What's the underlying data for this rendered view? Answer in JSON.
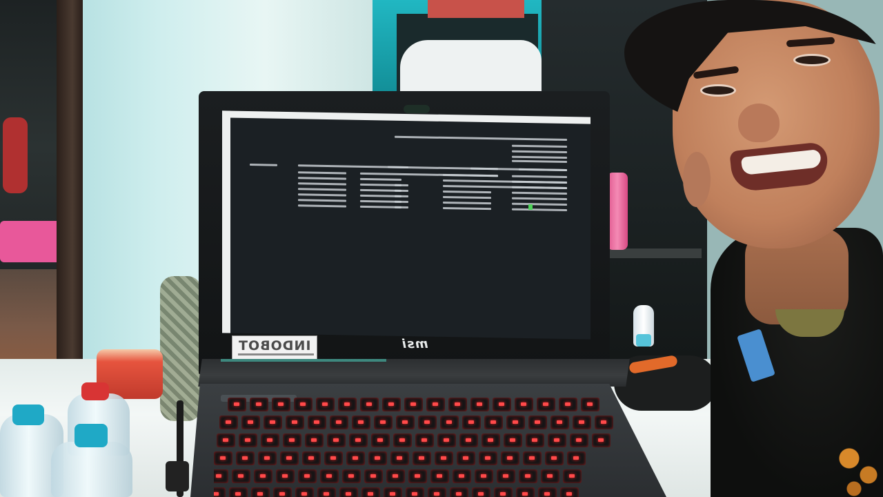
{
  "scene": {
    "laptop_brand_text": "msi",
    "sticker_text": "INDOBOT",
    "keyboard_backlight_color": "#ff3b3b",
    "terminal_cursor_color": "#4fd35a",
    "wall_color": "#d7eeee"
  }
}
